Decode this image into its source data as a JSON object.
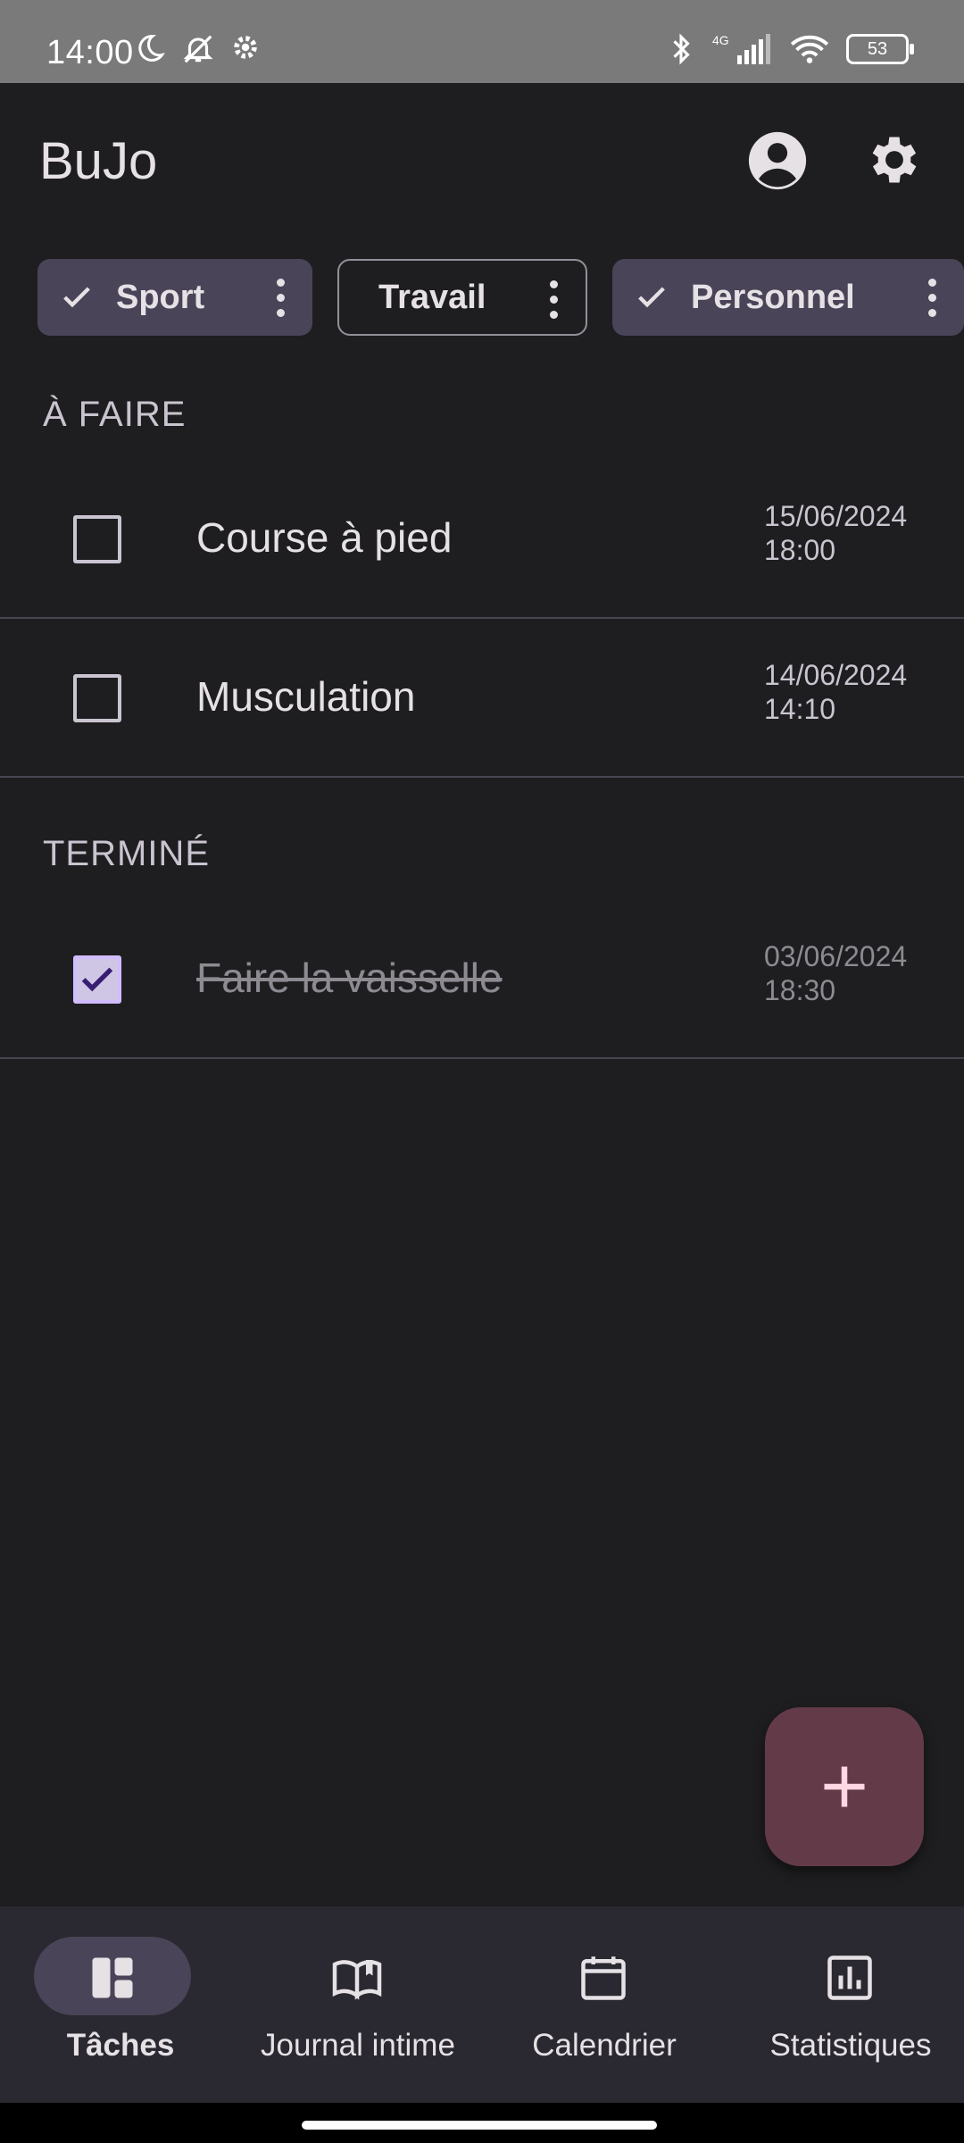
{
  "status_bar": {
    "time": "14:00",
    "battery": "53",
    "icons": [
      "moon-icon",
      "mute-icon",
      "gear-icon",
      "bluetooth-icon",
      "signal-4g-icon",
      "wifi-icon",
      "battery-icon"
    ]
  },
  "app_bar": {
    "title": "BuJo",
    "actions": [
      "account-icon",
      "settings-icon"
    ]
  },
  "filters": [
    {
      "label": "Sport",
      "selected": true
    },
    {
      "label": "Travail",
      "selected": false
    },
    {
      "label": "Personnel",
      "selected": true
    }
  ],
  "sections": {
    "todo": {
      "header": "À FAIRE",
      "tasks": [
        {
          "title": "Course à pied",
          "date": "15/06/2024",
          "time": "18:00",
          "done": false
        },
        {
          "title": "Musculation",
          "date": "14/06/2024",
          "time": "14:10",
          "done": false
        }
      ]
    },
    "done": {
      "header": "TERMINÉ",
      "tasks": [
        {
          "title": "Faire la vaisselle",
          "date": "03/06/2024",
          "time": "18:30",
          "done": true
        }
      ]
    }
  },
  "fab": {
    "icon": "plus-icon"
  },
  "bottom_nav": [
    {
      "label": "Tâches",
      "icon": "dashboard-icon",
      "active": true
    },
    {
      "label": "Journal intime",
      "icon": "book-icon",
      "active": false
    },
    {
      "label": "Calendrier",
      "icon": "calendar-icon",
      "active": false
    },
    {
      "label": "Statistiques",
      "icon": "chart-icon",
      "active": false
    }
  ],
  "colors": {
    "background": "#1e1e20",
    "chip_selected": "#4a4458",
    "fab": "#633b48",
    "nav_background": "#2a2830",
    "status_bar": "#7a7a7a"
  }
}
